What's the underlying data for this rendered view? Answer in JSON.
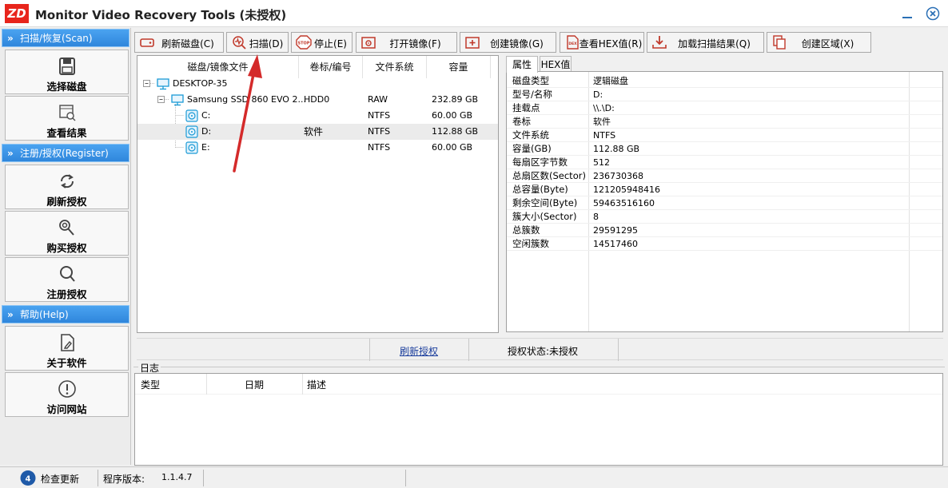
{
  "window": {
    "logo_text": "ZD",
    "title": "Monitor Video Recovery Tools (未授权)",
    "minimize_label": "—",
    "close_label": "✕"
  },
  "sidebar": {
    "sections": [
      {
        "header": "扫描/恢复(Scan)",
        "items": [
          {
            "label": "选择磁盘",
            "icon": "disk-icon"
          },
          {
            "label": "查看结果",
            "icon": "view-results-icon"
          }
        ]
      },
      {
        "header": "注册/授权(Register)",
        "items": [
          {
            "label": "刷新授权",
            "icon": "refresh-icon"
          },
          {
            "label": "购买授权",
            "icon": "key-icon"
          },
          {
            "label": "注册授权",
            "icon": "magnify-icon"
          }
        ]
      },
      {
        "header": "帮助(Help)",
        "items": [
          {
            "label": "关于软件",
            "icon": "document-icon"
          },
          {
            "label": "访问网站",
            "icon": "info-icon"
          }
        ]
      }
    ]
  },
  "toolbar": [
    {
      "label": "刷新磁盘(C)",
      "icon": "refresh-disk-icon"
    },
    {
      "label": "扫描(D)",
      "icon": "scan-icon"
    },
    {
      "label": "停止(E)",
      "icon": "stop-icon"
    },
    {
      "label": "打开镜像(F)",
      "icon": "open-image-icon"
    },
    {
      "label": "创建镜像(G)",
      "icon": "create-image-icon"
    },
    {
      "label": "查看HEX值(R)",
      "icon": "hex-icon"
    },
    {
      "label": "加载扫描结果(Q)",
      "icon": "load-results-icon"
    },
    {
      "label": "创建区域(X)",
      "icon": "create-region-icon"
    }
  ],
  "tree": {
    "columns": [
      "磁盘/镜像文件",
      "卷标/编号",
      "文件系统",
      "容量"
    ],
    "rows": [
      {
        "name": "DESKTOP-35",
        "label": "",
        "fs": "",
        "cap": "",
        "level": 0,
        "icon": "computer-icon"
      },
      {
        "name": "Samsung SSD 860 EVO 2...",
        "label": "HDD0",
        "fs": "RAW",
        "cap": "232.89 GB",
        "level": 1,
        "icon": "monitor-icon"
      },
      {
        "name": "C:",
        "label": "",
        "fs": "NTFS",
        "cap": "60.00 GB",
        "level": 2,
        "icon": "volume-icon"
      },
      {
        "name": "D:",
        "label": "软件",
        "fs": "NTFS",
        "cap": "112.88 GB",
        "level": 2,
        "icon": "volume-icon",
        "selected": true
      },
      {
        "name": "E:",
        "label": "",
        "fs": "NTFS",
        "cap": "60.00 GB",
        "level": 2,
        "icon": "volume-icon"
      }
    ]
  },
  "properties": {
    "tabs": [
      "属性",
      "HEX值"
    ],
    "rows": [
      {
        "key": "磁盘类型",
        "value": "逻辑磁盘"
      },
      {
        "key": "型号/名称",
        "value": "D:"
      },
      {
        "key": "挂载点",
        "value": "\\\\.\\D:"
      },
      {
        "key": "卷标",
        "value": "软件"
      },
      {
        "key": "文件系统",
        "value": "NTFS"
      },
      {
        "key": "容量(GB)",
        "value": "112.88 GB"
      },
      {
        "key": "每扇区字节数",
        "value": "512"
      },
      {
        "key": "总扇区数(Sector)",
        "value": "236730368"
      },
      {
        "key": "总容量(Byte)",
        "value": "121205948416"
      },
      {
        "key": "剩余空间(Byte)",
        "value": "59463516160"
      },
      {
        "key": "簇大小(Sector)",
        "value": "8"
      },
      {
        "key": "总簇数",
        "value": "29591295"
      },
      {
        "key": "空闲簇数",
        "value": "14517460"
      }
    ]
  },
  "license_bar": {
    "refresh_link": "刷新授权",
    "status": "授权状态:未授权"
  },
  "log": {
    "title": "日志",
    "columns": [
      "类型",
      "日期",
      "描述"
    ]
  },
  "status_bar": {
    "check_update": "检查更新",
    "version_label": "程序版本:",
    "version": "1.1.4.7"
  },
  "colors": {
    "brand": "#e8251c",
    "section_header": "#2f86dc",
    "annotation_arrow": "#d42a2a",
    "link": "#1a3d9c"
  }
}
